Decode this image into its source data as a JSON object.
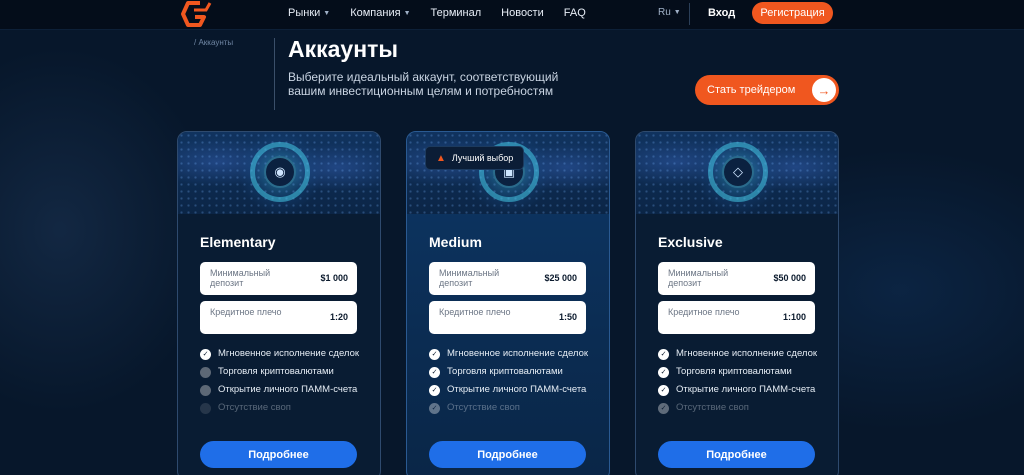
{
  "header": {
    "logo_name": "logo-g",
    "nav": [
      {
        "label": "Рынки",
        "dropdown": true
      },
      {
        "label": "Компания",
        "dropdown": true
      },
      {
        "label": "Терминал",
        "dropdown": false
      },
      {
        "label": "Новости",
        "dropdown": false
      },
      {
        "label": "FAQ",
        "dropdown": false
      }
    ],
    "language": "Ru",
    "login_label": "Вход",
    "register_label": "Регистрация"
  },
  "hero": {
    "breadcrumb": "/ Аккаунты",
    "title": "Аккаунты",
    "subtitle": "Выберите идеальный аккаунт, соответствующий вашим инвестиционным целям и потребностям",
    "cta_label": "Стать трейдером",
    "cta_icon": "arrow-right-icon"
  },
  "colors": {
    "accent_orange": "#f0571f",
    "button_blue": "#1f6ee8",
    "background": "#07172b"
  },
  "cards": [
    {
      "name": "Elementary",
      "icon": "piggy-bank-icon",
      "badge": "",
      "deposit_label": "Минимальный депозит",
      "deposit_value": "$1 000",
      "leverage_label": "Кредитное плечо",
      "leverage_value": "1:20",
      "features": [
        {
          "text": "Мгновенное исполнение сделок",
          "enabled": true
        },
        {
          "text": "Торговля криптовалютами",
          "enabled": false
        },
        {
          "text": "Открытие личного ПАММ-счета",
          "enabled": false
        },
        {
          "text": "Отсутствие своп",
          "enabled": false
        }
      ],
      "button_label": "Подробнее"
    },
    {
      "name": "Medium",
      "icon": "wallet-icon",
      "badge": "Лучший выбор",
      "deposit_label": "Минимальный депозит",
      "deposit_value": "$25 000",
      "leverage_label": "Кредитное плечо",
      "leverage_value": "1:50",
      "features": [
        {
          "text": "Мгновенное исполнение сделок",
          "enabled": true
        },
        {
          "text": "Торговля криптовалютами",
          "enabled": true
        },
        {
          "text": "Открытие личного ПАММ-счета",
          "enabled": true
        },
        {
          "text": "Отсутствие своп",
          "enabled": true
        }
      ],
      "button_label": "Подробнее"
    },
    {
      "name": "Exclusive",
      "icon": "diamond-icon",
      "badge": "",
      "deposit_label": "Минимальный депозит",
      "deposit_value": "$50 000",
      "leverage_label": "Кредитное плечо",
      "leverage_value": "1:100",
      "features": [
        {
          "text": "Мгновенное исполнение сделок",
          "enabled": true
        },
        {
          "text": "Торговля криптовалютами",
          "enabled": true
        },
        {
          "text": "Открытие личного ПАММ-счета",
          "enabled": true
        },
        {
          "text": "Отсутствие своп",
          "enabled": true
        }
      ],
      "button_label": "Подробнее"
    }
  ]
}
